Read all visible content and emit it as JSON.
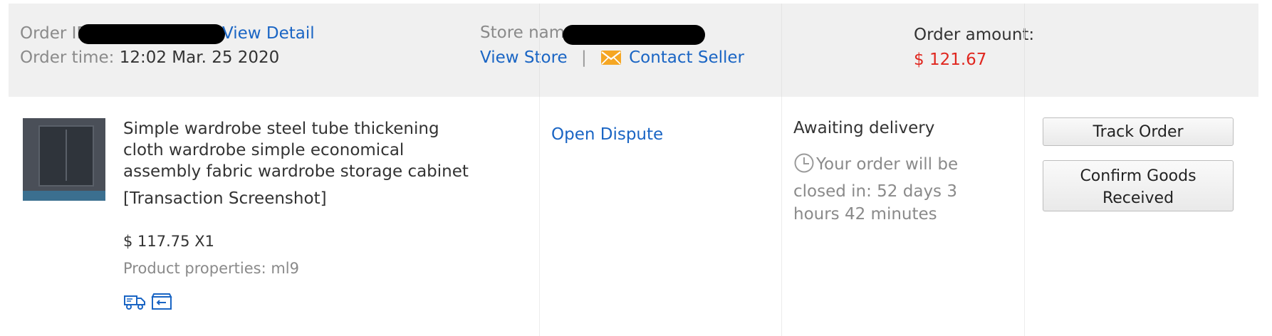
{
  "order": {
    "id_label": "Order ID",
    "view_detail": "View Detail",
    "time_label": "Order time:",
    "time_value": "12:02 Mar. 25 2020"
  },
  "store": {
    "name_label": "Store name:",
    "view_store": "View Store",
    "separator": "|",
    "contact_seller": "Contact Seller",
    "mail_icon_color": "#f5a623"
  },
  "amount": {
    "label": "Order amount:",
    "value": "$ 121.67",
    "color": "#e0271f"
  },
  "product": {
    "title": "Simple wardrobe steel tube thickening cloth wardrobe simple economical assembly fabric wardrobe storage cabinet",
    "snapshot": "[Transaction Screenshot]",
    "price": "$ 117.75 X1",
    "properties": "Product properties: ml9",
    "icons": [
      "shipping-truck-icon",
      "return-box-icon"
    ]
  },
  "dispute": {
    "label": "Open Dispute"
  },
  "status": {
    "text": "Awaiting delivery",
    "countdown": "Your order will be closed in: 52 days 3 hours 42 minutes"
  },
  "actions": {
    "track": "Track Order",
    "confirm": "Confirm Goods Received"
  },
  "colors": {
    "link": "#1a65c4",
    "header_bg": "#f0f0f0"
  }
}
